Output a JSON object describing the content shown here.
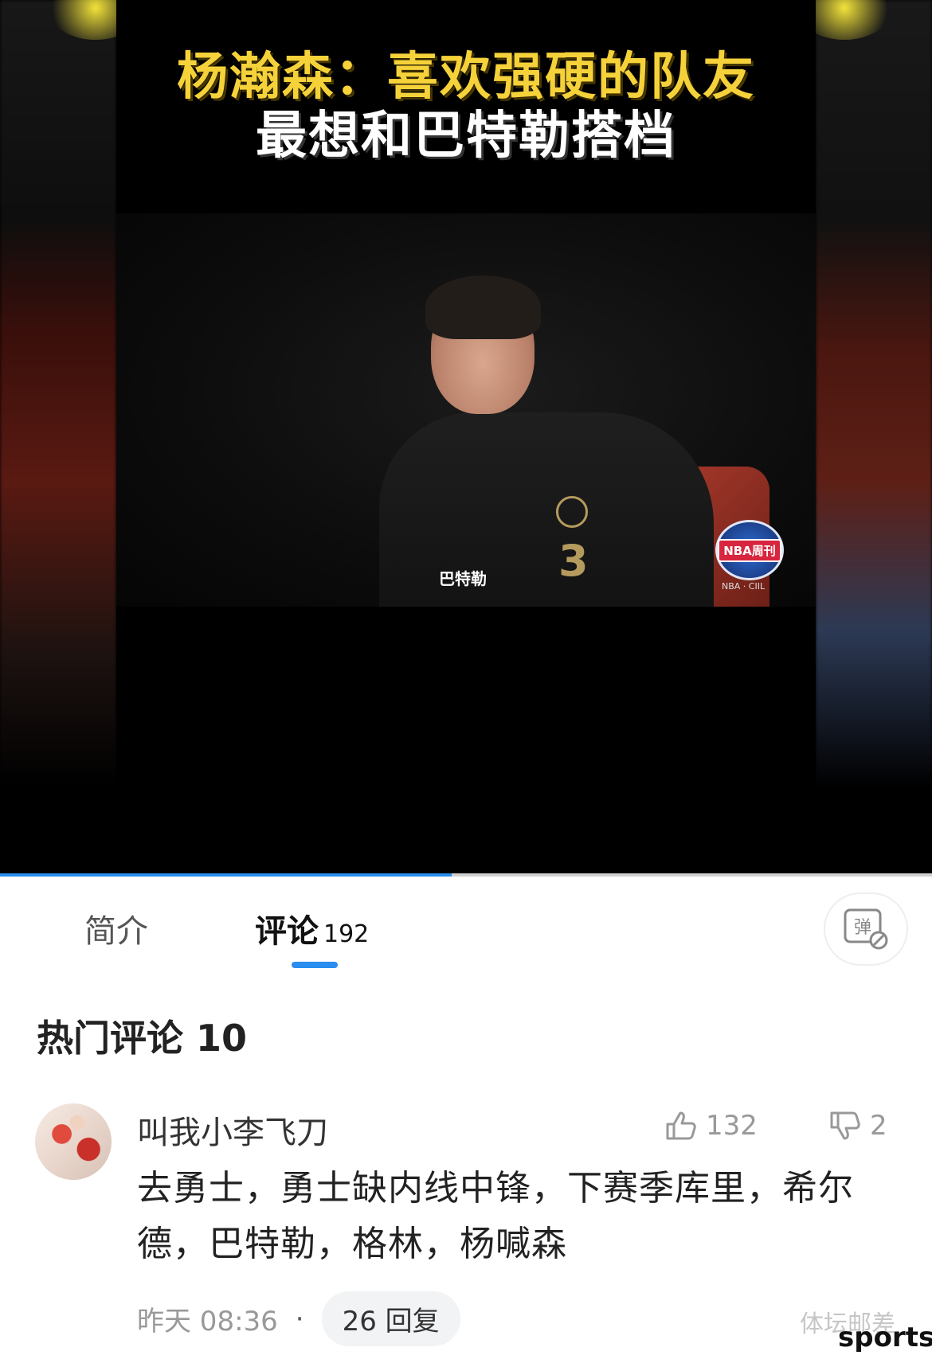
{
  "video": {
    "title_line1": "杨瀚森：喜欢强硬的队友",
    "title_line2": "最想和巴特勒搭档",
    "shirt_text": "巴特勒",
    "jersey_number": "3",
    "show_logo_text": "NBA周刊",
    "show_logo_sub": "NBA · CIIL",
    "progress_fraction": 0.485
  },
  "tabs": {
    "intro_label": "简介",
    "comments_label": "评论",
    "comments_count": "192",
    "danmu_label": "弹"
  },
  "hot_comments": {
    "title": "热门评论 10"
  },
  "comment": {
    "username": "叫我小李飞刀",
    "likes": "132",
    "dislikes": "2",
    "body": "去勇士，勇士缺内线中锋，下赛季库里，希尔德，巴特勒，格林，杨喊森",
    "time": "昨天 08:36",
    "separator": "·",
    "replies": "26 回复"
  },
  "watermark": {
    "text": "体坛邮差",
    "sports": "sports"
  },
  "colors": {
    "accent": "#2a8df0",
    "title_yellow": "#f6d23a"
  }
}
